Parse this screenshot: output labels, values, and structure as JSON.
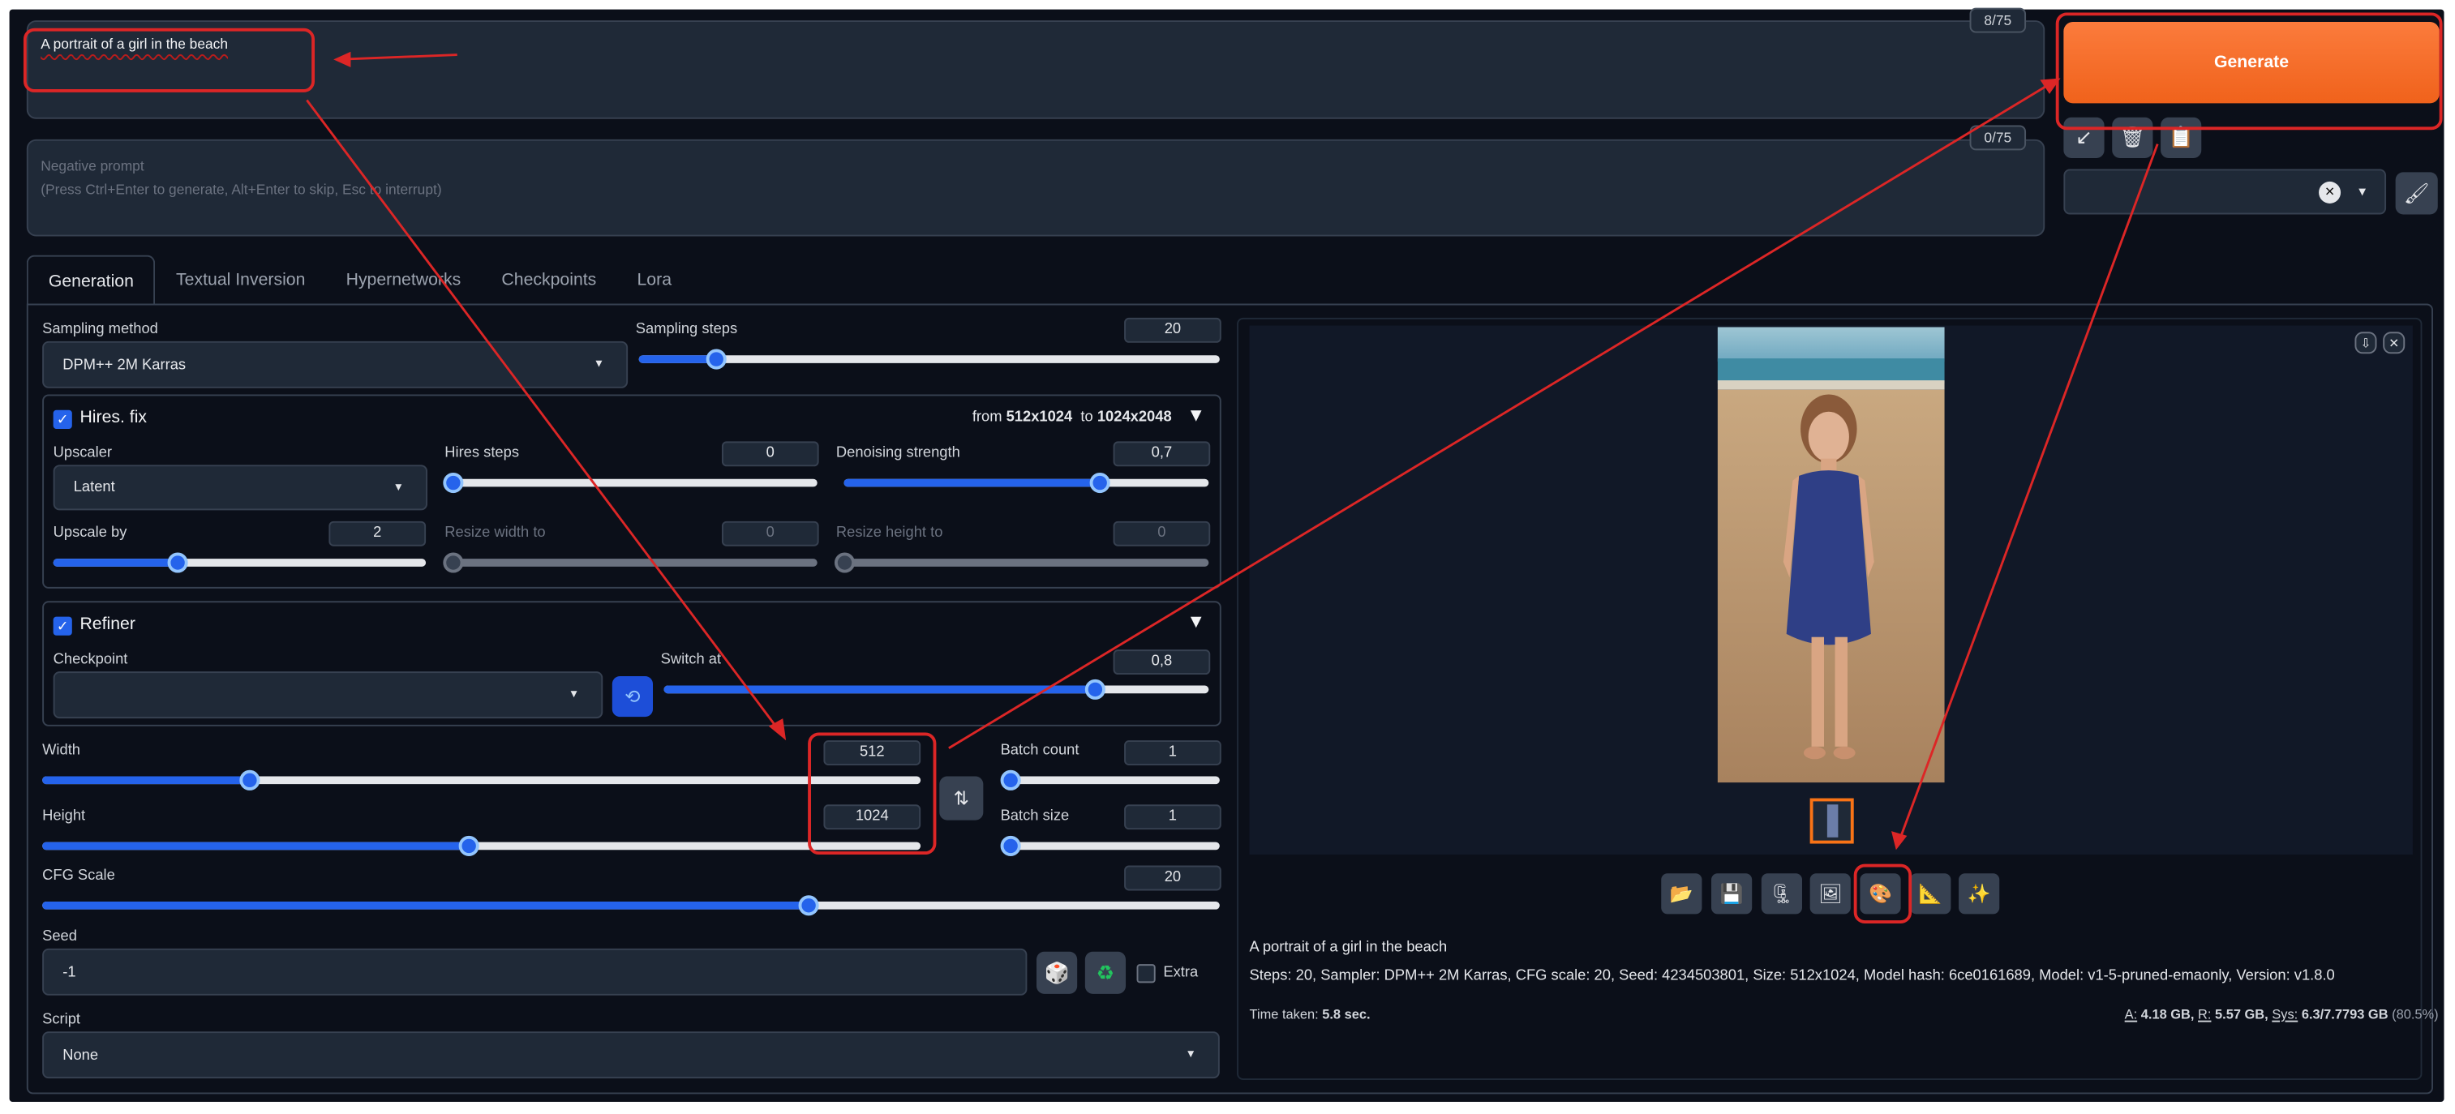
{
  "prompt": {
    "text": "A portrait of a girl in the beach",
    "counter": "8/75"
  },
  "negative_prompt": {
    "placeholder_line1": "Negative prompt",
    "placeholder_line2": "(Press Ctrl+Enter to generate, Alt+Enter to skip, Esc to interrupt)",
    "counter": "0/75"
  },
  "generate": {
    "label": "Generate"
  },
  "action_icons": {
    "arrow": "↙",
    "trash": "🗑",
    "clipboard": "📋",
    "paint": "🖌",
    "clear": "✕",
    "dropdown": "▾"
  },
  "tabs": [
    "Generation",
    "Textual Inversion",
    "Hypernetworks",
    "Checkpoints",
    "Lora"
  ],
  "sampling": {
    "method_label": "Sampling method",
    "method_value": "DPM++ 2M Karras",
    "steps_label": "Sampling steps",
    "steps_value": "20",
    "steps_level": 0.133
  },
  "hires": {
    "title": "Hires. fix",
    "checked": true,
    "summary_prefix": "from",
    "from": "512x1024",
    "summary_to": "to",
    "to": "1024x2048",
    "upscaler_label": "Upscaler",
    "upscaler_value": "Latent",
    "steps_label": "Hires steps",
    "steps_value": "0",
    "steps_level": 0,
    "denoise_label": "Denoising strength",
    "denoise_value": "0,7",
    "denoise_level": 0.7,
    "upscale_by_label": "Upscale by",
    "upscale_by_value": "2",
    "upscale_by_level": 0.33,
    "resize_w_label": "Resize width to",
    "resize_w_value": "0",
    "resize_h_label": "Resize height to",
    "resize_h_value": "0"
  },
  "refiner": {
    "title": "Refiner",
    "checked": true,
    "checkpoint_label": "Checkpoint",
    "checkpoint_value": "",
    "switch_label": "Switch at",
    "switch_value": "0,8",
    "switch_level": 0.79
  },
  "size": {
    "width_label": "Width",
    "width_value": "512",
    "width_level": 0.235,
    "height_label": "Height",
    "height_value": "1024",
    "height_level": 0.485
  },
  "batch": {
    "count_label": "Batch count",
    "count_value": "1",
    "count_level": 0,
    "size_label": "Batch size",
    "size_value": "1",
    "size_level": 0
  },
  "cfg": {
    "label": "CFG Scale",
    "value": "20",
    "level": 0.65
  },
  "seed": {
    "label": "Seed",
    "value": "-1",
    "extra_label": "Extra",
    "extra_checked": false,
    "dice_icon": "🎲",
    "recycle_icon": "♻"
  },
  "script": {
    "label": "Script",
    "value": "None"
  },
  "output": {
    "caption": "A portrait of a girl in the beach",
    "params": "Steps: 20, Sampler: DPM++ 2M Karras, CFG scale: 20, Seed: 4234503801, Size: 512x1024, Model hash: 6ce0161689, Model: v1-5-pruned-emaonly, Version: v1.8.0",
    "time_label": "Time taken:",
    "time_value": "5.8 sec.",
    "mem_a_label": "A:",
    "mem_a": "4.18 GB,",
    "mem_r_label": "R:",
    "mem_r": "5.57 GB,",
    "mem_sys_label": "Sys:",
    "mem_sys": "6.3/7.7793 GB",
    "mem_pct": "(80.5%)",
    "tool_icons": [
      "📂",
      "💾",
      "🗜",
      "🖼",
      "🎨",
      "📐",
      "✨"
    ]
  },
  "colors": {
    "bg": "#0b0f19",
    "panel": "#1f2937",
    "accent": "#2563eb",
    "generate": "#f26a21",
    "annotation": "#dc2626"
  }
}
